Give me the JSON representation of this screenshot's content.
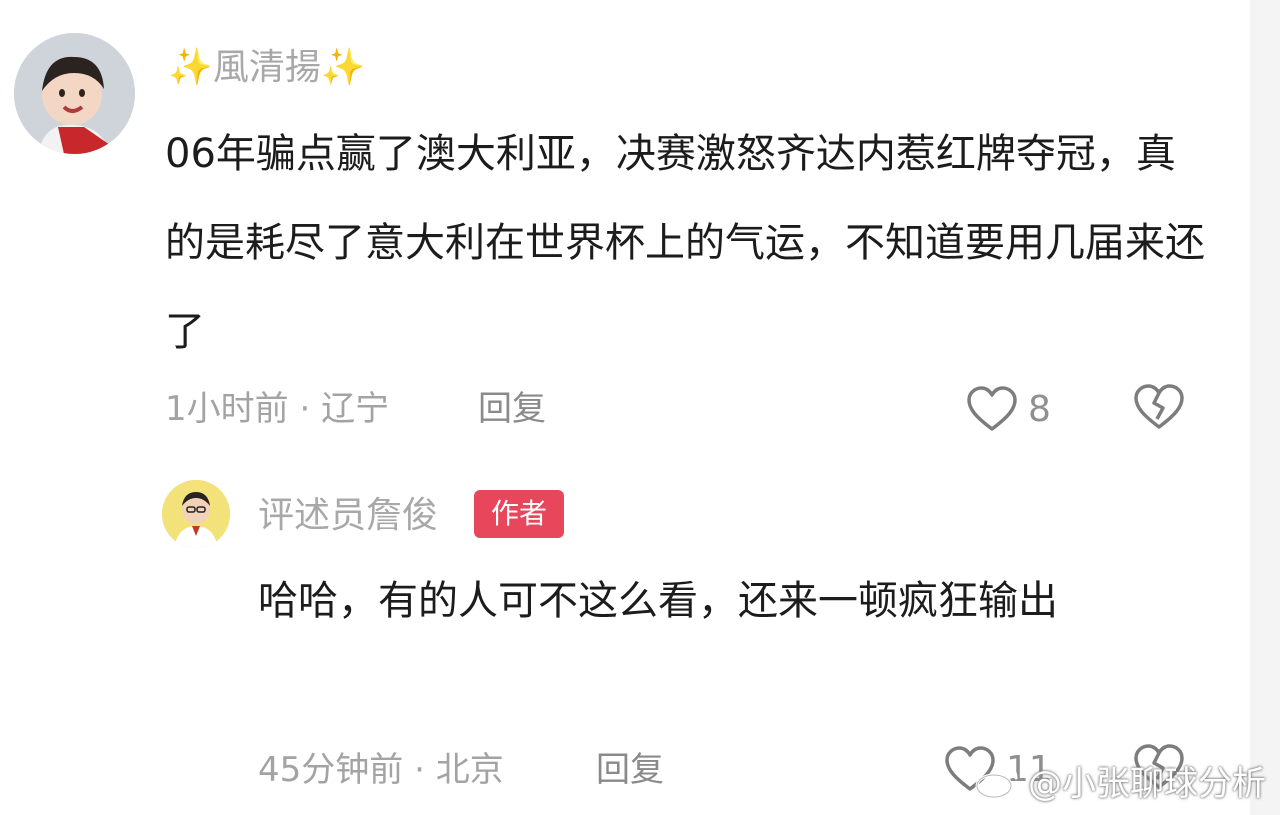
{
  "comments": [
    {
      "username": "風清揚",
      "username_decoration": "✨",
      "text": "06年骗点赢了澳大利亚，决赛激怒齐达内惹红牌夺冠，真的是耗尽了意大利在世界杯上的气运，不知道要用几届来还了",
      "time": "1小时前",
      "location": "辽宁",
      "separator": "·",
      "reply_label": "回复",
      "likes": "8"
    },
    {
      "username": "评述员詹俊",
      "badge": "作者",
      "text": "哈哈，有的人可不这么看，还来一顿疯狂输出",
      "time": "45分钟前",
      "location": "北京",
      "separator": "·",
      "reply_label": "回复",
      "likes": "11"
    }
  ],
  "watermark": {
    "text": "@小张聊球分析",
    "icon": "weibo-icon"
  },
  "icons": {
    "like": "heart-outline-icon",
    "dislike": "broken-heart-icon"
  },
  "colors": {
    "badge": "#e8465a",
    "text": "#1c1c1c",
    "meta": "#a3a3a3",
    "username": "#a8a8a8"
  }
}
